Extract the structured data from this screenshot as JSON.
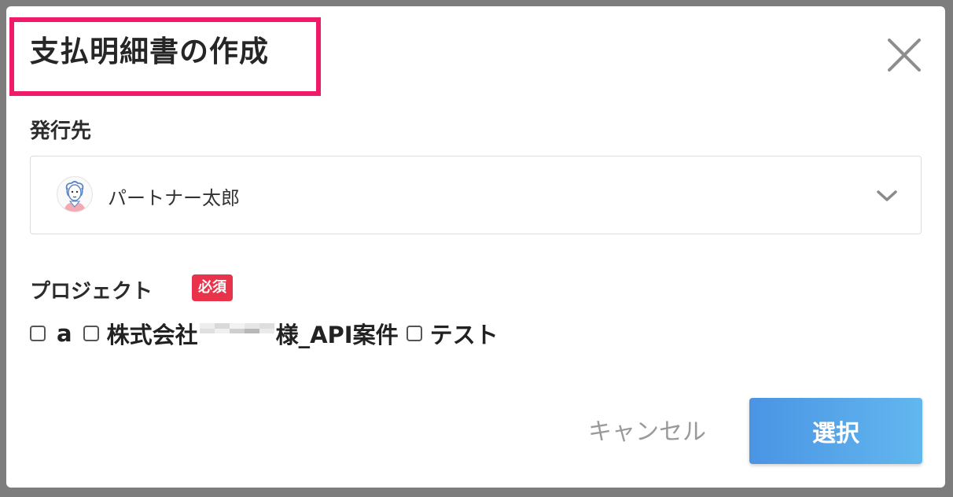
{
  "dialog": {
    "title": "支払明細書の作成",
    "close_icon": "close-icon",
    "highlight_color": "#f01a6a"
  },
  "issuer": {
    "label": "発行先",
    "selected_value": "パートナー太郎",
    "avatar_icon": "user-avatar-icon",
    "dropdown_icon": "chevron-down-icon"
  },
  "project": {
    "label": "プロジェクト",
    "required_badge": "必須",
    "required_color": "#e8334a",
    "options": [
      {
        "label": "a",
        "checked": false
      },
      {
        "label_prefix": "株式会社",
        "label_suffix": "様_API案件",
        "checked": false
      },
      {
        "label": "テスト",
        "checked": false
      }
    ]
  },
  "footer": {
    "cancel_label": "キャンセル",
    "select_label": "選択",
    "primary_color": "#4a94e4"
  }
}
